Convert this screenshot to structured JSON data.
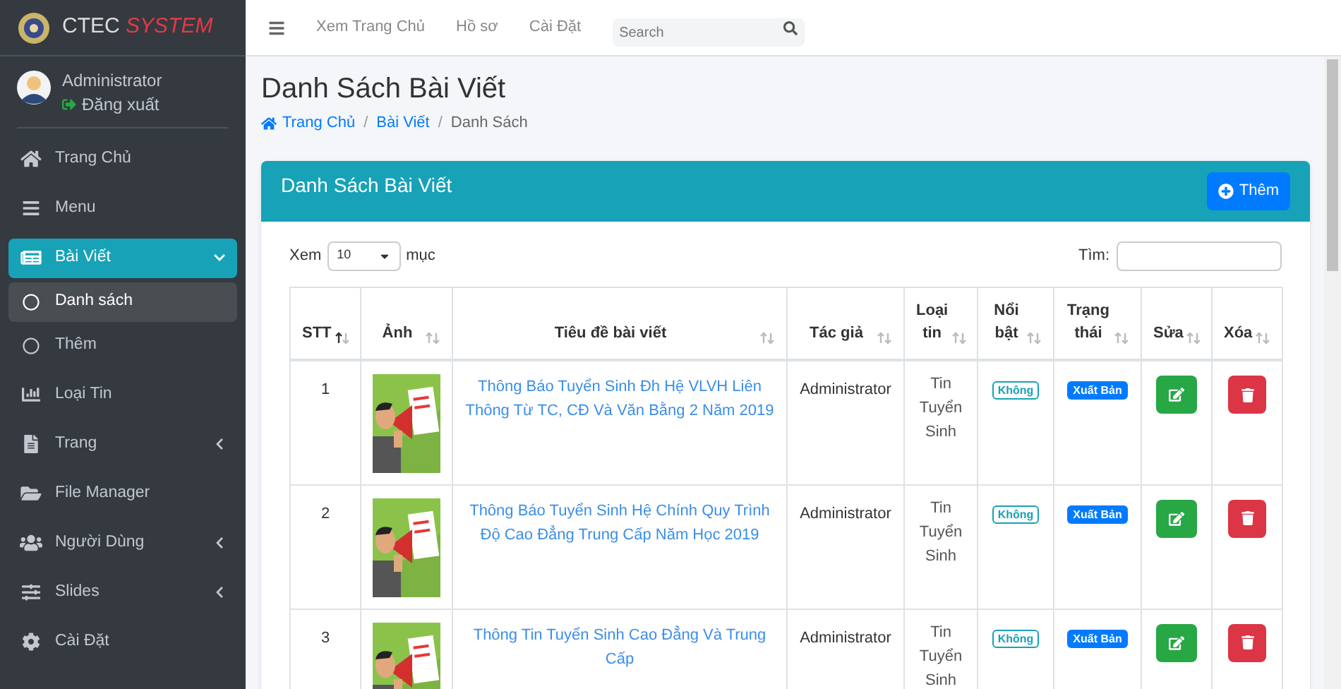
{
  "brand": {
    "text": "CTEC",
    "accent": "SYSTEM"
  },
  "user": {
    "name": "Administrator",
    "logout": "Đăng xuất"
  },
  "sidebar": {
    "items": [
      {
        "label": "Trang Chủ",
        "kind": "home",
        "selected": false
      },
      {
        "label": "Menu",
        "kind": "menu",
        "selected": false
      },
      {
        "label": "Bài Viết",
        "kind": "news",
        "selected": true,
        "expanded": true,
        "children": [
          {
            "label": "Danh sách",
            "selected": true
          },
          {
            "label": "Thêm",
            "selected": false
          }
        ]
      },
      {
        "label": "Loại Tin",
        "kind": "chart",
        "selected": false
      },
      {
        "label": "Trang",
        "kind": "file",
        "selected": false,
        "expanded": false
      },
      {
        "label": "File Manager",
        "kind": "folder",
        "selected": false
      },
      {
        "label": "Người Dùng",
        "kind": "users",
        "selected": false,
        "expanded": false
      },
      {
        "label": "Slides",
        "kind": "sliders",
        "selected": false,
        "expanded": false
      },
      {
        "label": "Cài Đặt",
        "kind": "gear",
        "selected": false
      }
    ]
  },
  "topnav": {
    "links": [
      "Xem Trang Chủ",
      "Hồ sơ",
      "Cài Đặt"
    ],
    "search": {
      "placeholder": "Search"
    }
  },
  "page": {
    "title": "Danh Sách Bài Viết",
    "breadcrumb": [
      {
        "label": "Trang Chủ",
        "link": true
      },
      {
        "separator": "/",
        "label": "Bài Viết",
        "link": true
      },
      {
        "separator": "/",
        "label": "Danh Sách",
        "link": false
      }
    ]
  },
  "card": {
    "title": "Danh Sách Bài Viết",
    "add_button": "Thêm",
    "length_before": "Xem",
    "length_value": "10",
    "length_after": "mục",
    "search_label": "Tìm:"
  },
  "table": {
    "columns": [
      {
        "label": "STT",
        "sorted": true
      },
      {
        "label": "Ảnh",
        "sorted": false
      },
      {
        "label": "Tiêu đề bài viết",
        "sorted": false
      },
      {
        "label": "Tác giả",
        "sorted": false
      },
      {
        "label": "Loại tin",
        "sorted": false
      },
      {
        "label": "Nổi bật",
        "sorted": false
      },
      {
        "label": "Trạng thái",
        "sorted": false
      },
      {
        "label": "Sửa",
        "sorted": false
      },
      {
        "label": "Xóa",
        "sorted": false
      }
    ],
    "rows": [
      {
        "stt": "1",
        "title": "Thông Báo Tuyển Sinh Đh Hệ VLVH Liên Thông Từ TC, CĐ Và Văn Bằng 2 Năm 2019",
        "author": "Administrator",
        "category": "Tin Tuyển Sinh",
        "featured": "Không",
        "status": "Xuất Bản"
      },
      {
        "stt": "2",
        "title": "Thông Báo Tuyển Sinh Hệ Chính Quy Trình Độ Cao Đẳng Trung Cấp Năm Học 2019",
        "author": "Administrator",
        "category": "Tin Tuyển Sinh",
        "featured": "Không",
        "status": "Xuất Bản"
      },
      {
        "stt": "3",
        "title": "Thông Tin Tuyển Sinh Cao Đẳng Và Trung Cấp",
        "author": "Administrator",
        "category": "Tin Tuyển Sinh",
        "featured": "Không",
        "status": "Xuất Bản"
      }
    ]
  }
}
